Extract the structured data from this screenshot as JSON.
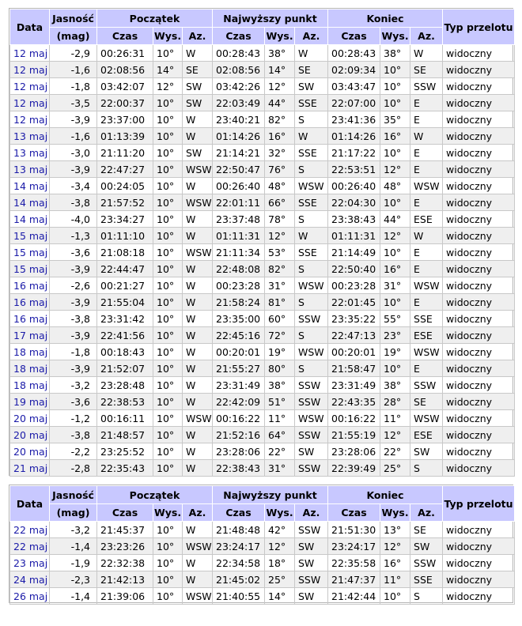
{
  "headers": {
    "date": "Data",
    "mag": "Jasność",
    "mag_unit": "(mag)",
    "start": "Początek",
    "peak": "Najwyższy punkt",
    "end": "Koniec",
    "type": "Typ przelotu",
    "time": "Czas",
    "alt": "Wys.",
    "az": "Az."
  },
  "table1": [
    [
      "12 maj",
      "-2,9",
      "00:26:31",
      "10°",
      "W",
      "00:28:43",
      "38°",
      "W",
      "00:28:43",
      "38°",
      "W",
      "widoczny"
    ],
    [
      "12 maj",
      "-1,6",
      "02:08:56",
      "14°",
      "SE",
      "02:08:56",
      "14°",
      "SE",
      "02:09:34",
      "10°",
      "SE",
      "widoczny"
    ],
    [
      "12 maj",
      "-1,8",
      "03:42:07",
      "12°",
      "SW",
      "03:42:26",
      "12°",
      "SW",
      "03:43:47",
      "10°",
      "SSW",
      "widoczny"
    ],
    [
      "12 maj",
      "-3,5",
      "22:00:37",
      "10°",
      "SW",
      "22:03:49",
      "44°",
      "SSE",
      "22:07:00",
      "10°",
      "E",
      "widoczny"
    ],
    [
      "12 maj",
      "-3,9",
      "23:37:00",
      "10°",
      "W",
      "23:40:21",
      "82°",
      "S",
      "23:41:36",
      "35°",
      "E",
      "widoczny"
    ],
    [
      "13 maj",
      "-1,6",
      "01:13:39",
      "10°",
      "W",
      "01:14:26",
      "16°",
      "W",
      "01:14:26",
      "16°",
      "W",
      "widoczny"
    ],
    [
      "13 maj",
      "-3,0",
      "21:11:20",
      "10°",
      "SW",
      "21:14:21",
      "32°",
      "SSE",
      "21:17:22",
      "10°",
      "E",
      "widoczny"
    ],
    [
      "13 maj",
      "-3,9",
      "22:47:27",
      "10°",
      "WSW",
      "22:50:47",
      "76°",
      "S",
      "22:53:51",
      "12°",
      "E",
      "widoczny"
    ],
    [
      "14 maj",
      "-3,4",
      "00:24:05",
      "10°",
      "W",
      "00:26:40",
      "48°",
      "WSW",
      "00:26:40",
      "48°",
      "WSW",
      "widoczny"
    ],
    [
      "14 maj",
      "-3,8",
      "21:57:52",
      "10°",
      "WSW",
      "22:01:11",
      "66°",
      "SSE",
      "22:04:30",
      "10°",
      "E",
      "widoczny"
    ],
    [
      "14 maj",
      "-4,0",
      "23:34:27",
      "10°",
      "W",
      "23:37:48",
      "78°",
      "S",
      "23:38:43",
      "44°",
      "ESE",
      "widoczny"
    ],
    [
      "15 maj",
      "-1,3",
      "01:11:10",
      "10°",
      "W",
      "01:11:31",
      "12°",
      "W",
      "01:11:31",
      "12°",
      "W",
      "widoczny"
    ],
    [
      "15 maj",
      "-3,6",
      "21:08:18",
      "10°",
      "WSW",
      "21:11:34",
      "53°",
      "SSE",
      "21:14:49",
      "10°",
      "E",
      "widoczny"
    ],
    [
      "15 maj",
      "-3,9",
      "22:44:47",
      "10°",
      "W",
      "22:48:08",
      "82°",
      "S",
      "22:50:40",
      "16°",
      "E",
      "widoczny"
    ],
    [
      "16 maj",
      "-2,6",
      "00:21:27",
      "10°",
      "W",
      "00:23:28",
      "31°",
      "WSW",
      "00:23:28",
      "31°",
      "WSW",
      "widoczny"
    ],
    [
      "16 maj",
      "-3,9",
      "21:55:04",
      "10°",
      "W",
      "21:58:24",
      "81°",
      "S",
      "22:01:45",
      "10°",
      "E",
      "widoczny"
    ],
    [
      "16 maj",
      "-3,8",
      "23:31:42",
      "10°",
      "W",
      "23:35:00",
      "60°",
      "SSW",
      "23:35:22",
      "55°",
      "SSE",
      "widoczny"
    ],
    [
      "17 maj",
      "-3,9",
      "22:41:56",
      "10°",
      "W",
      "22:45:16",
      "72°",
      "S",
      "22:47:13",
      "23°",
      "ESE",
      "widoczny"
    ],
    [
      "18 maj",
      "-1,8",
      "00:18:43",
      "10°",
      "W",
      "00:20:01",
      "19°",
      "WSW",
      "00:20:01",
      "19°",
      "WSW",
      "widoczny"
    ],
    [
      "18 maj",
      "-3,9",
      "21:52:07",
      "10°",
      "W",
      "21:55:27",
      "80°",
      "S",
      "21:58:47",
      "10°",
      "E",
      "widoczny"
    ],
    [
      "18 maj",
      "-3,2",
      "23:28:48",
      "10°",
      "W",
      "23:31:49",
      "38°",
      "SSW",
      "23:31:49",
      "38°",
      "SSW",
      "widoczny"
    ],
    [
      "19 maj",
      "-3,6",
      "22:38:53",
      "10°",
      "W",
      "22:42:09",
      "51°",
      "SSW",
      "22:43:35",
      "28°",
      "SE",
      "widoczny"
    ],
    [
      "20 maj",
      "-1,2",
      "00:16:11",
      "10°",
      "WSW",
      "00:16:22",
      "11°",
      "WSW",
      "00:16:22",
      "11°",
      "WSW",
      "widoczny"
    ],
    [
      "20 maj",
      "-3,8",
      "21:48:57",
      "10°",
      "W",
      "21:52:16",
      "64°",
      "SSW",
      "21:55:19",
      "12°",
      "ESE",
      "widoczny"
    ],
    [
      "20 maj",
      "-2,2",
      "23:25:52",
      "10°",
      "W",
      "23:28:06",
      "22°",
      "SW",
      "23:28:06",
      "22°",
      "SW",
      "widoczny"
    ],
    [
      "21 maj",
      "-2,8",
      "22:35:43",
      "10°",
      "W",
      "22:38:43",
      "31°",
      "SSW",
      "22:39:49",
      "25°",
      "S",
      "widoczny"
    ]
  ],
  "table2": [
    [
      "22 maj",
      "-3,2",
      "21:45:37",
      "10°",
      "W",
      "21:48:48",
      "42°",
      "SSW",
      "21:51:30",
      "13°",
      "SE",
      "widoczny"
    ],
    [
      "22 maj",
      "-1,4",
      "23:23:26",
      "10°",
      "WSW",
      "23:24:17",
      "12°",
      "SW",
      "23:24:17",
      "12°",
      "SW",
      "widoczny"
    ],
    [
      "23 maj",
      "-1,9",
      "22:32:38",
      "10°",
      "W",
      "22:34:58",
      "18°",
      "SW",
      "22:35:58",
      "16°",
      "SSW",
      "widoczny"
    ],
    [
      "24 maj",
      "-2,3",
      "21:42:13",
      "10°",
      "W",
      "21:45:02",
      "25°",
      "SSW",
      "21:47:37",
      "11°",
      "SSE",
      "widoczny"
    ],
    [
      "26 maj",
      "-1,4",
      "21:39:06",
      "10°",
      "WSW",
      "21:40:55",
      "14°",
      "SW",
      "21:42:44",
      "10°",
      "S",
      "widoczny"
    ]
  ]
}
